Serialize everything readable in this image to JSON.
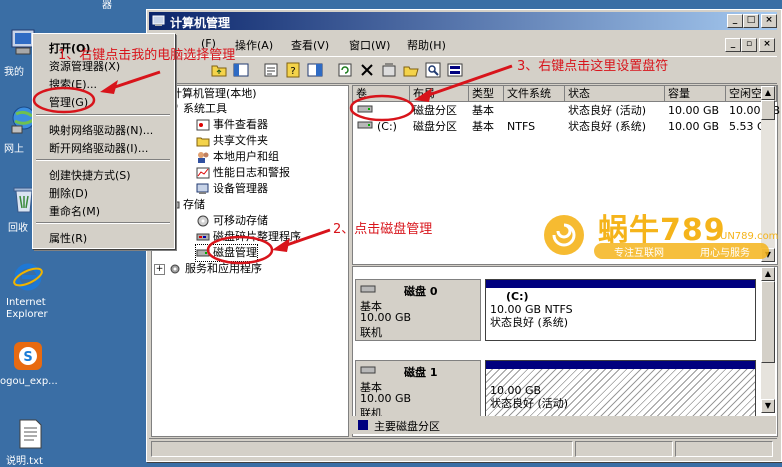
{
  "desktop": {
    "top_label": "器",
    "icons": [
      {
        "label": "我的",
        "icon": "my-computer-icon"
      },
      {
        "label": "网上",
        "icon": "network-icon"
      },
      {
        "label": "回收",
        "icon": "recycle-bin-icon"
      },
      {
        "label": "Internet",
        "label2": "Explorer",
        "icon": "ie-icon"
      },
      {
        "label": "ogou_exp...",
        "icon": "sogou-icon"
      },
      {
        "label": "说明.txt",
        "icon": "text-file-icon"
      }
    ]
  },
  "window": {
    "title": "计算机管理",
    "controls": {
      "minimize": "_",
      "maximize": "□",
      "close": "×"
    },
    "menu": [
      "(F)",
      "操作(A)",
      "查看(V)",
      "窗口(W)",
      "帮助(H)"
    ],
    "mdi_controls": {
      "minimize": "_",
      "restore": "▫",
      "close": "×"
    }
  },
  "tree": {
    "items": [
      {
        "label": "计算机管理(本地)",
        "icon": "computer-icon"
      },
      {
        "label": "系统工具",
        "icon": "tools-icon"
      },
      {
        "label": "事件查看器",
        "icon": "event-viewer-icon"
      },
      {
        "label": "共享文件夹",
        "icon": "shared-folder-icon"
      },
      {
        "label": "本地用户和组",
        "icon": "users-icon"
      },
      {
        "label": "性能日志和警报",
        "icon": "performance-icon"
      },
      {
        "label": "设备管理器",
        "icon": "device-manager-icon"
      },
      {
        "label": "存储",
        "icon": "storage-icon"
      },
      {
        "label": "可移动存储",
        "icon": "removable-storage-icon"
      },
      {
        "label": "磁盘碎片整理程序",
        "icon": "defrag-icon"
      },
      {
        "label": "磁盘管理",
        "icon": "disk-management-icon"
      },
      {
        "label": "服务和应用程序",
        "icon": "services-icon"
      }
    ],
    "expand_symbol": "+"
  },
  "list": {
    "columns": [
      "卷",
      "布局",
      "类型",
      "文件系统",
      "状态",
      "容量",
      "空闲空间"
    ],
    "rows": [
      {
        "volume": "",
        "layout": "磁盘分区",
        "type": "基本",
        "fs": "",
        "status": "状态良好 (活动)",
        "capacity": "10.00 GB",
        "free": "10.00 GB"
      },
      {
        "volume": "(C:)",
        "layout": "磁盘分区",
        "type": "基本",
        "fs": "NTFS",
        "status": "状态良好 (系统)",
        "capacity": "10.00 GB",
        "free": "5.53 GB"
      }
    ]
  },
  "disks": [
    {
      "name": "磁盘 0",
      "type": "基本",
      "size": "10.00 GB",
      "state": "联机",
      "partition": {
        "name": "(C:)",
        "detail": "10.00 GB NTFS",
        "status": "状态良好 (系统)"
      }
    },
    {
      "name": "磁盘 1",
      "type": "基本",
      "size": "10.00 GB",
      "state": "联机",
      "partition": {
        "name": "",
        "detail": "10.00 GB",
        "status": "状态良好 (活动)"
      }
    }
  ],
  "legend": {
    "label": "主要磁盘分区",
    "color": "#00007f"
  },
  "context_menu": {
    "items": [
      "打开(O)",
      "资源管理器(X)",
      "搜索(E)...",
      "管理(G)",
      "映射网络驱动器(N)...",
      "断开网络驱动器(I)...",
      "创建快捷方式(S)",
      "删除(D)",
      "重命名(M)",
      "属性(R)"
    ]
  },
  "annotations": {
    "step1": "1、右键点击我的电脑选择管理",
    "step2": "2、点击磁盘管理",
    "step3": "3、右键点击这里设置盘符",
    "color": "#d8141b"
  },
  "watermark": {
    "brand": "蜗牛789",
    "site": "UN789.com",
    "slogan1": "专注互联网",
    "slogan2": "用心与服务"
  }
}
